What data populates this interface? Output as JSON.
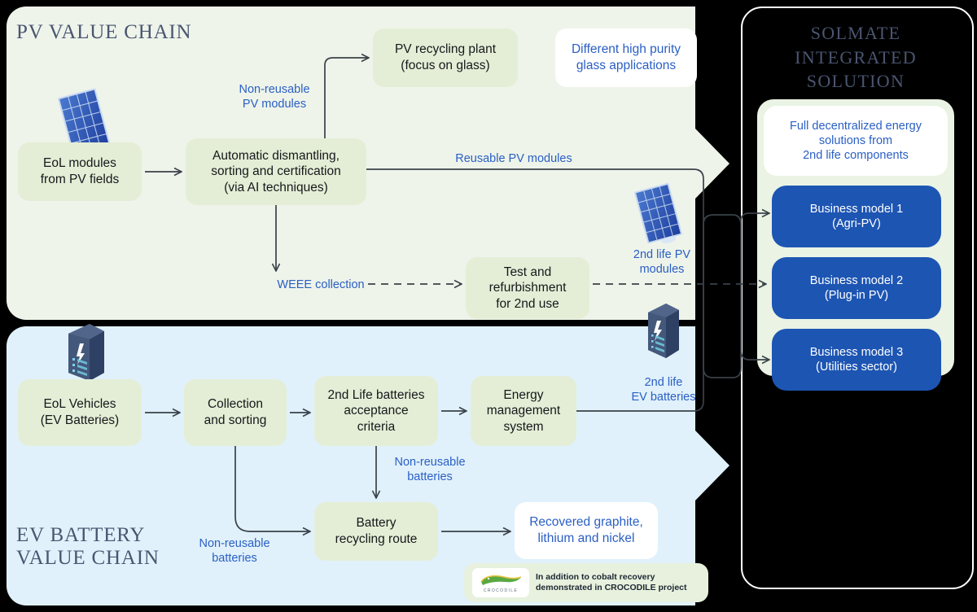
{
  "pv_chain": {
    "title": "PV VALUE CHAIN",
    "icon": "solar-panel-icon",
    "nodes": {
      "eol_modules": "EoL modules\nfrom PV fields",
      "dismantling": "Automatic dismantling,\nsorting and certification\n(via AI techniques)",
      "recycling_plant": "PV recycling plant\n(focus on glass)",
      "glass_applications": "Different high purity\nglass applications",
      "test_refurbishment": "Test and\nrefurbishment\nfor 2nd use"
    },
    "labels": {
      "non_reusable_modules": "Non-reusable\nPV modules",
      "reusable_modules": "Reusable PV modules",
      "weee_collection": "WEEE collection",
      "second_life_pv": "2nd life PV\nmodules"
    }
  },
  "ev_chain": {
    "title": "EV BATTERY\nVALUE CHAIN",
    "icon": "battery-storage-icon",
    "nodes": {
      "eol_vehicles": "EoL Vehicles\n(EV Batteries)",
      "collection_sorting": "Collection\nand sorting",
      "acceptance_criteria": "2nd Life batteries\nacceptance\ncriteria",
      "energy_management": "Energy\nmanagement\nsystem",
      "battery_recycling": "Battery\nrecycling route",
      "recovered_materials": "Recovered graphite,\nlithium and nickel"
    },
    "labels": {
      "non_reusable_batteries_left": "Non-reusable\nbatteries",
      "non_reusable_batteries_mid": "Non-reusable\nbatteries",
      "second_life_ev": "2nd life\nEV batteries"
    },
    "note": {
      "logo_text": "CROCODILE",
      "text": "In addition to cobalt recovery\ndemonstrated in CROCODILE project"
    }
  },
  "solmate": {
    "title": "SOLMATE\nINTEGRATED\nSOLUTION",
    "headline": "Full decentralized energy\nsolutions from\n2nd life components",
    "business_models": [
      {
        "label": "Business model 1\n(Agri-PV)"
      },
      {
        "label": "Business model 2\n(Plug-in PV)"
      },
      {
        "label": "Business model 3\n(Utilities sector)"
      }
    ]
  },
  "colors": {
    "background": "#000000",
    "pv_panel": "#eef4ea",
    "ev_panel": "#e0f1fb",
    "green_box": "#e4eed6",
    "blue_accent": "#2a5fc4",
    "business_model": "#1d55b3",
    "title_text": "#4a5570",
    "line": "#3a4148"
  }
}
